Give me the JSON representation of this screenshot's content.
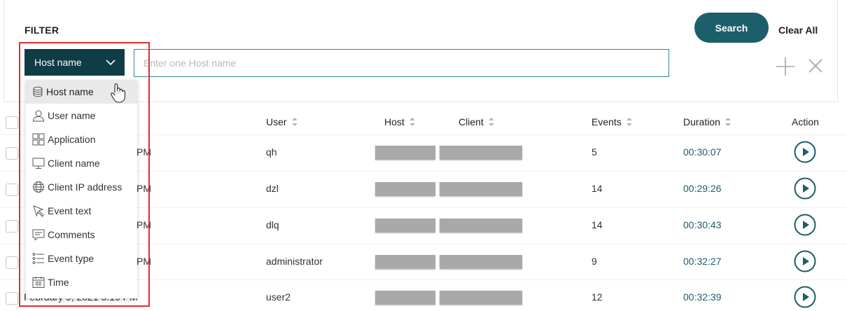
{
  "filter": {
    "title": "FILTER",
    "search_label": "Search",
    "clear_all_label": "Clear All",
    "selected_field": "Host name",
    "input_placeholder": "Enter one Host name"
  },
  "dropdown": {
    "items": [
      {
        "label": "Host name",
        "icon": "database-icon"
      },
      {
        "label": "User name",
        "icon": "user-icon"
      },
      {
        "label": "Application",
        "icon": "grid-icon"
      },
      {
        "label": "Client name",
        "icon": "monitor-icon"
      },
      {
        "label": "Client IP address",
        "icon": "globe-icon"
      },
      {
        "label": "Event text",
        "icon": "cursor-arrow-icon"
      },
      {
        "label": "Comments",
        "icon": "comment-icon"
      },
      {
        "label": "Event type",
        "icon": "list-icon"
      },
      {
        "label": "Time",
        "icon": "calendar-icon"
      }
    ]
  },
  "table": {
    "headers": {
      "user": "User",
      "host": "Host",
      "client": "Client",
      "events": "Events",
      "duration": "Duration",
      "action": "Action"
    },
    "rows": [
      {
        "time": "PM",
        "user": "qh",
        "events": "5",
        "duration": "00:30:07"
      },
      {
        "time": "PM",
        "user": "dzl",
        "events": "14",
        "duration": "00:29:26"
      },
      {
        "time": "PM",
        "user": "dlq",
        "events": "14",
        "duration": "00:30:43"
      },
      {
        "time": "PM",
        "user": "administrator",
        "events": "9",
        "duration": "00:32:27"
      },
      {
        "time": "February 9, 2021 5:19 PM",
        "user": "user2",
        "events": "12",
        "duration": "00:32:39"
      }
    ]
  },
  "colors": {
    "accent": "#1d5e6b",
    "select_bg": "#0f3d46",
    "highlight": "#e32c2c"
  }
}
